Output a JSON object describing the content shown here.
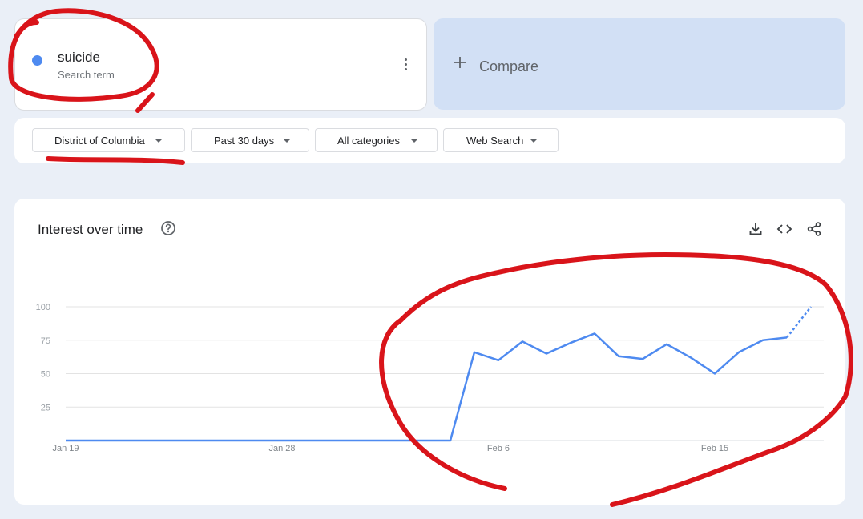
{
  "term": {
    "name": "suicide",
    "subtitle": "Search term",
    "dot_color": "#4e8af0",
    "menu_icon": "more-vert-icon"
  },
  "compare": {
    "label": "Compare",
    "icon": "plus-icon"
  },
  "filters": [
    {
      "label": "District of Columbia",
      "icon": "caret-down-icon"
    },
    {
      "label": "Past 30 days",
      "icon": "caret-down-icon"
    },
    {
      "label": "All categories",
      "icon": "caret-down-icon"
    },
    {
      "label": "Web Search",
      "icon": "caret-down-icon"
    }
  ],
  "chart_card": {
    "title": "Interest over time",
    "help_icon": "help-circle-icon",
    "tools": [
      "download-icon",
      "embed-code-icon",
      "share-icon"
    ]
  },
  "chart_data": {
    "type": "line",
    "ylim": [
      0,
      100
    ],
    "yticks": [
      25,
      50,
      75,
      100
    ],
    "xticks": [
      "Jan 19",
      "Jan 28",
      "Feb 6",
      "Feb 15"
    ],
    "grid": true,
    "line_color": "#4e8af0",
    "series": [
      {
        "values": [
          0,
          0,
          0,
          0,
          0,
          0,
          0,
          0,
          0,
          0,
          0,
          0,
          0,
          0,
          0,
          0,
          0,
          66,
          60,
          74,
          65,
          73,
          80,
          63,
          61,
          72,
          62,
          50,
          66,
          75,
          77,
          100
        ],
        "partial_last": true
      }
    ]
  },
  "annotations": {
    "color": "#d9141a",
    "marks": [
      "term-circle",
      "location-underline",
      "chart-spike-circle"
    ]
  }
}
